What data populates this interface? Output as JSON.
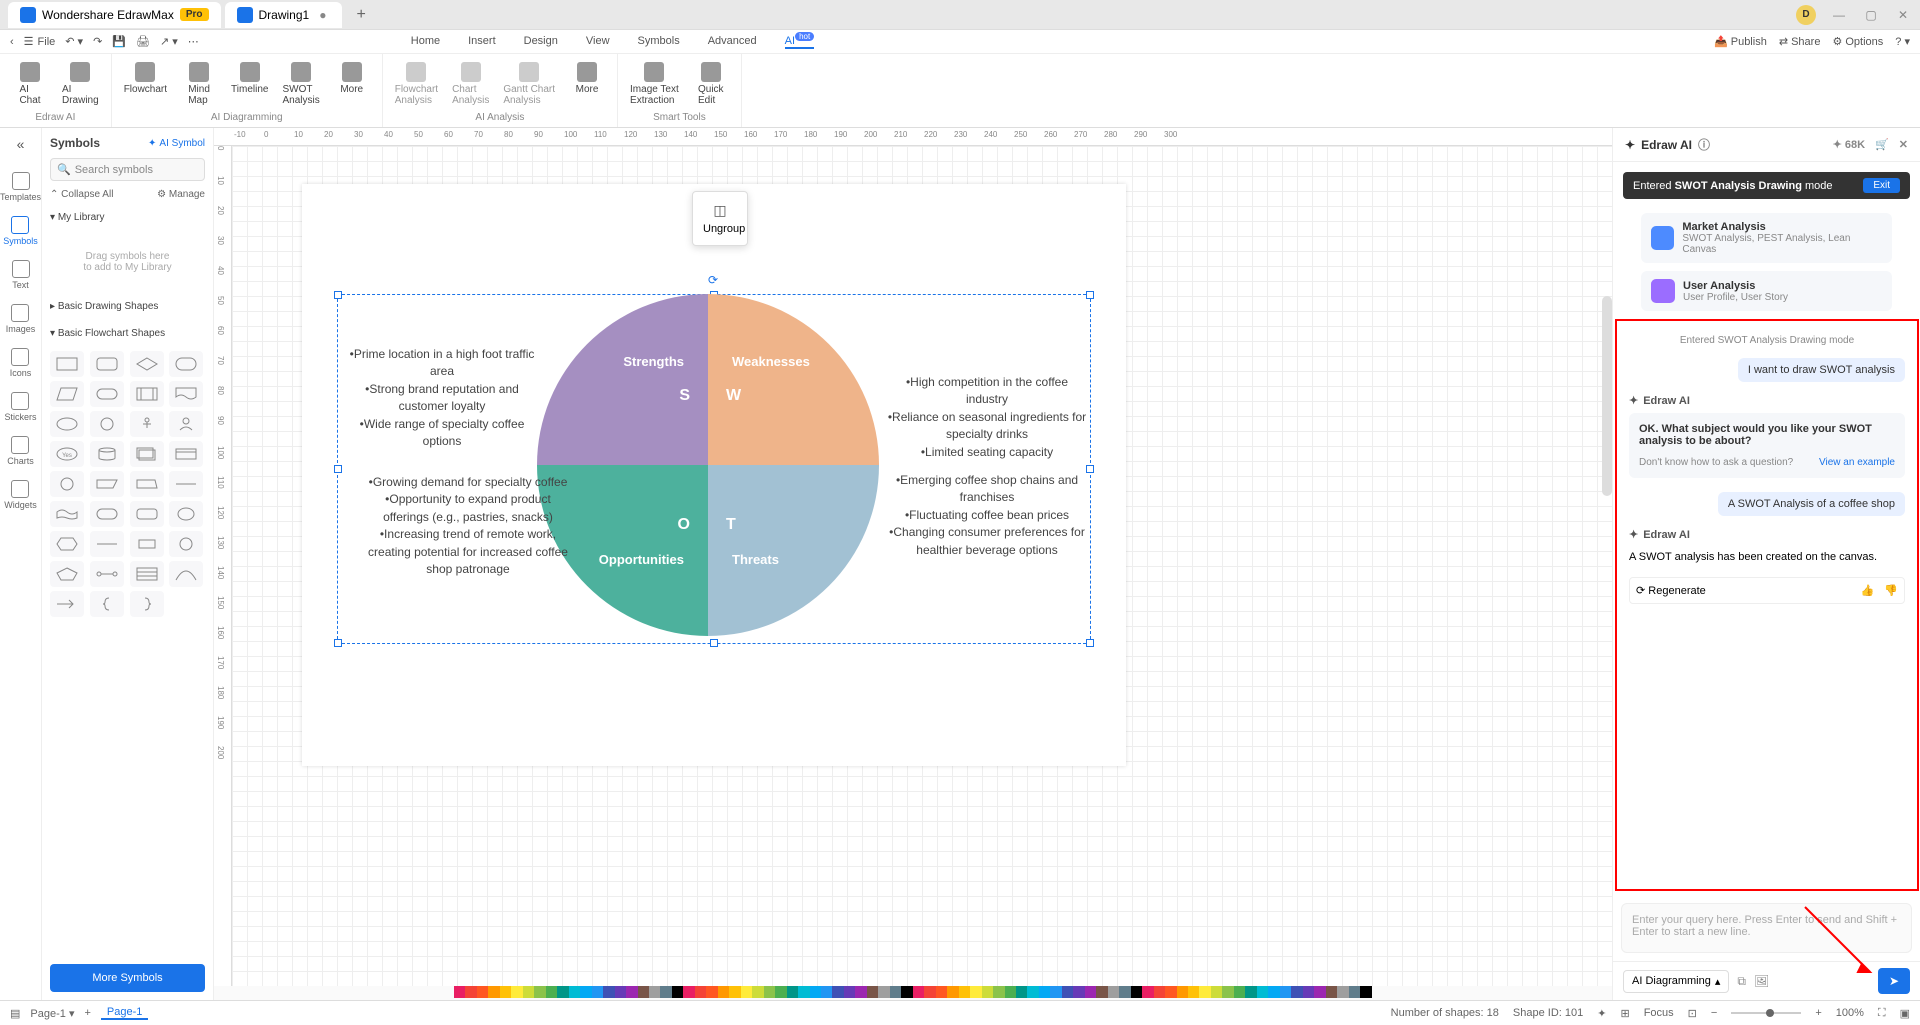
{
  "titlebar": {
    "app_name": "Wondershare EdrawMax",
    "pro": "Pro",
    "tab2": "Drawing1",
    "avatar": "D"
  },
  "menubar": {
    "file": "File",
    "items": [
      "Home",
      "Insert",
      "Design",
      "View",
      "Symbols",
      "Advanced",
      "AI"
    ],
    "hot": "hot",
    "publish": "Publish",
    "share": "Share",
    "options": "Options"
  },
  "ribbon": {
    "group1": {
      "b1": "AI\nChat",
      "b2": "AI\nDrawing",
      "cap": "Edraw AI"
    },
    "group2": {
      "b1": "Flowchart",
      "b2": "Mind\nMap",
      "b3": "Timeline",
      "b4": "SWOT\nAnalysis",
      "b5": "More",
      "cap": "AI Diagramming"
    },
    "group3": {
      "b1": "Flowchart\nAnalysis",
      "b2": "Chart\nAnalysis",
      "b3": "Gantt Chart\nAnalysis",
      "b4": "More",
      "cap": "AI Analysis"
    },
    "group4": {
      "b1": "Image Text\nExtraction",
      "b2": "Quick\nEdit",
      "cap": "Smart Tools"
    }
  },
  "leftbar": [
    "Templates",
    "Symbols",
    "Text",
    "Images",
    "Icons",
    "Stickers",
    "Charts",
    "Widgets"
  ],
  "symbols": {
    "title": "Symbols",
    "ai_symbol": "AI Symbol",
    "search_ph": "Search symbols",
    "collapse": "Collapse All",
    "manage": "Manage",
    "mylib": "My Library",
    "drop1": "Drag symbols here",
    "drop2": "to add to My Library",
    "cat1": "Basic Drawing Shapes",
    "cat2": "Basic Flowchart Shapes",
    "more": "More Symbols"
  },
  "canvas": {
    "ungroup": "Ungroup"
  },
  "swot": {
    "q1": {
      "title": "Strengths",
      "letter": "S"
    },
    "q2": {
      "title": "Weaknesses",
      "letter": "W"
    },
    "q3": {
      "title": "Opportunities",
      "letter": "O"
    },
    "q4": {
      "title": "Threats",
      "letter": "T"
    },
    "text1": "•Prime location in a high foot traffic area\n•Strong brand reputation and customer loyalty\n•Wide range of specialty coffee options",
    "text2": "•High competition in the coffee industry\n•Reliance on seasonal ingredients for specialty drinks\n•Limited seating capacity",
    "text3": "•Growing demand for specialty coffee\n•Opportunity to expand product offerings (e.g., pastries, snacks)\n•Increasing trend of remote work, creating potential for increased coffee shop patronage",
    "text4": "•Emerging coffee shop chains and franchises\n•Fluctuating coffee bean prices\n•Changing consumer preferences for healthier beverage options"
  },
  "ai": {
    "title": "Edraw AI",
    "tokens": "68K",
    "mode_prefix": "Entered ",
    "mode_bold": "SWOT Analysis Drawing",
    "mode_suffix": " mode",
    "exit": "Exit",
    "card1": {
      "t": "Market Analysis",
      "s": "SWOT Analysis, PEST Analysis, Lean Canvas"
    },
    "card2": {
      "t": "User Analysis",
      "s": "User Profile, User Story"
    },
    "chat_status": "Entered SWOT Analysis Drawing mode",
    "u1": "I want to draw SWOT analysis",
    "ai_label": "Edraw AI",
    "a1": "OK. What subject would you like your SWOT analysis to be about?",
    "a1_hint": "Don't know how to ask a question?",
    "a1_example": "View an example",
    "u2": "A SWOT Analysis of a coffee shop",
    "a2": "A SWOT analysis has been created on the canvas.",
    "regen": "Regenerate",
    "input_ph": "Enter your query here. Press Enter to send and Shift + Enter to start a new line.",
    "select": "AI Diagramming"
  },
  "statusbar": {
    "page": "Page-1",
    "page_tab": "Page-1",
    "shapes": "Number of shapes: 18",
    "shape_id": "Shape ID: 101",
    "focus": "Focus",
    "zoom": "100%"
  },
  "ruler_h": [
    "-10",
    "0",
    "10",
    "20",
    "30",
    "40",
    "50",
    "60",
    "70",
    "80",
    "90",
    "100",
    "110",
    "120",
    "130",
    "140",
    "150",
    "160",
    "170",
    "180",
    "190",
    "200",
    "210",
    "220",
    "230",
    "240",
    "250",
    "260",
    "270",
    "280",
    "290",
    "300"
  ],
  "ruler_v": [
    "0",
    "10",
    "20",
    "30",
    "40",
    "50",
    "60",
    "70",
    "80",
    "90",
    "100",
    "110",
    "120",
    "130",
    "140",
    "150",
    "160",
    "170",
    "180",
    "190",
    "200"
  ]
}
